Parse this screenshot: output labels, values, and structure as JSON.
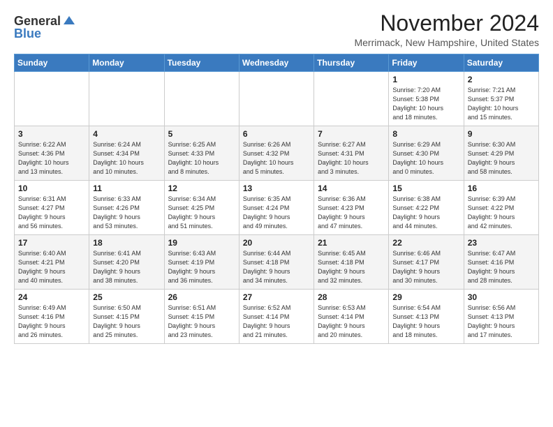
{
  "header": {
    "logo_general": "General",
    "logo_blue": "Blue",
    "month_title": "November 2024",
    "subtitle": "Merrimack, New Hampshire, United States"
  },
  "days_of_week": [
    "Sunday",
    "Monday",
    "Tuesday",
    "Wednesday",
    "Thursday",
    "Friday",
    "Saturday"
  ],
  "weeks": [
    [
      {
        "day": "",
        "info": ""
      },
      {
        "day": "",
        "info": ""
      },
      {
        "day": "",
        "info": ""
      },
      {
        "day": "",
        "info": ""
      },
      {
        "day": "",
        "info": ""
      },
      {
        "day": "1",
        "info": "Sunrise: 7:20 AM\nSunset: 5:38 PM\nDaylight: 10 hours\nand 18 minutes."
      },
      {
        "day": "2",
        "info": "Sunrise: 7:21 AM\nSunset: 5:37 PM\nDaylight: 10 hours\nand 15 minutes."
      }
    ],
    [
      {
        "day": "3",
        "info": "Sunrise: 6:22 AM\nSunset: 4:36 PM\nDaylight: 10 hours\nand 13 minutes."
      },
      {
        "day": "4",
        "info": "Sunrise: 6:24 AM\nSunset: 4:34 PM\nDaylight: 10 hours\nand 10 minutes."
      },
      {
        "day": "5",
        "info": "Sunrise: 6:25 AM\nSunset: 4:33 PM\nDaylight: 10 hours\nand 8 minutes."
      },
      {
        "day": "6",
        "info": "Sunrise: 6:26 AM\nSunset: 4:32 PM\nDaylight: 10 hours\nand 5 minutes."
      },
      {
        "day": "7",
        "info": "Sunrise: 6:27 AM\nSunset: 4:31 PM\nDaylight: 10 hours\nand 3 minutes."
      },
      {
        "day": "8",
        "info": "Sunrise: 6:29 AM\nSunset: 4:30 PM\nDaylight: 10 hours\nand 0 minutes."
      },
      {
        "day": "9",
        "info": "Sunrise: 6:30 AM\nSunset: 4:29 PM\nDaylight: 9 hours\nand 58 minutes."
      }
    ],
    [
      {
        "day": "10",
        "info": "Sunrise: 6:31 AM\nSunset: 4:27 PM\nDaylight: 9 hours\nand 56 minutes."
      },
      {
        "day": "11",
        "info": "Sunrise: 6:33 AM\nSunset: 4:26 PM\nDaylight: 9 hours\nand 53 minutes."
      },
      {
        "day": "12",
        "info": "Sunrise: 6:34 AM\nSunset: 4:25 PM\nDaylight: 9 hours\nand 51 minutes."
      },
      {
        "day": "13",
        "info": "Sunrise: 6:35 AM\nSunset: 4:24 PM\nDaylight: 9 hours\nand 49 minutes."
      },
      {
        "day": "14",
        "info": "Sunrise: 6:36 AM\nSunset: 4:23 PM\nDaylight: 9 hours\nand 47 minutes."
      },
      {
        "day": "15",
        "info": "Sunrise: 6:38 AM\nSunset: 4:22 PM\nDaylight: 9 hours\nand 44 minutes."
      },
      {
        "day": "16",
        "info": "Sunrise: 6:39 AM\nSunset: 4:22 PM\nDaylight: 9 hours\nand 42 minutes."
      }
    ],
    [
      {
        "day": "17",
        "info": "Sunrise: 6:40 AM\nSunset: 4:21 PM\nDaylight: 9 hours\nand 40 minutes."
      },
      {
        "day": "18",
        "info": "Sunrise: 6:41 AM\nSunset: 4:20 PM\nDaylight: 9 hours\nand 38 minutes."
      },
      {
        "day": "19",
        "info": "Sunrise: 6:43 AM\nSunset: 4:19 PM\nDaylight: 9 hours\nand 36 minutes."
      },
      {
        "day": "20",
        "info": "Sunrise: 6:44 AM\nSunset: 4:18 PM\nDaylight: 9 hours\nand 34 minutes."
      },
      {
        "day": "21",
        "info": "Sunrise: 6:45 AM\nSunset: 4:18 PM\nDaylight: 9 hours\nand 32 minutes."
      },
      {
        "day": "22",
        "info": "Sunrise: 6:46 AM\nSunset: 4:17 PM\nDaylight: 9 hours\nand 30 minutes."
      },
      {
        "day": "23",
        "info": "Sunrise: 6:47 AM\nSunset: 4:16 PM\nDaylight: 9 hours\nand 28 minutes."
      }
    ],
    [
      {
        "day": "24",
        "info": "Sunrise: 6:49 AM\nSunset: 4:16 PM\nDaylight: 9 hours\nand 26 minutes."
      },
      {
        "day": "25",
        "info": "Sunrise: 6:50 AM\nSunset: 4:15 PM\nDaylight: 9 hours\nand 25 minutes."
      },
      {
        "day": "26",
        "info": "Sunrise: 6:51 AM\nSunset: 4:15 PM\nDaylight: 9 hours\nand 23 minutes."
      },
      {
        "day": "27",
        "info": "Sunrise: 6:52 AM\nSunset: 4:14 PM\nDaylight: 9 hours\nand 21 minutes."
      },
      {
        "day": "28",
        "info": "Sunrise: 6:53 AM\nSunset: 4:14 PM\nDaylight: 9 hours\nand 20 minutes."
      },
      {
        "day": "29",
        "info": "Sunrise: 6:54 AM\nSunset: 4:13 PM\nDaylight: 9 hours\nand 18 minutes."
      },
      {
        "day": "30",
        "info": "Sunrise: 6:56 AM\nSunset: 4:13 PM\nDaylight: 9 hours\nand 17 minutes."
      }
    ]
  ]
}
